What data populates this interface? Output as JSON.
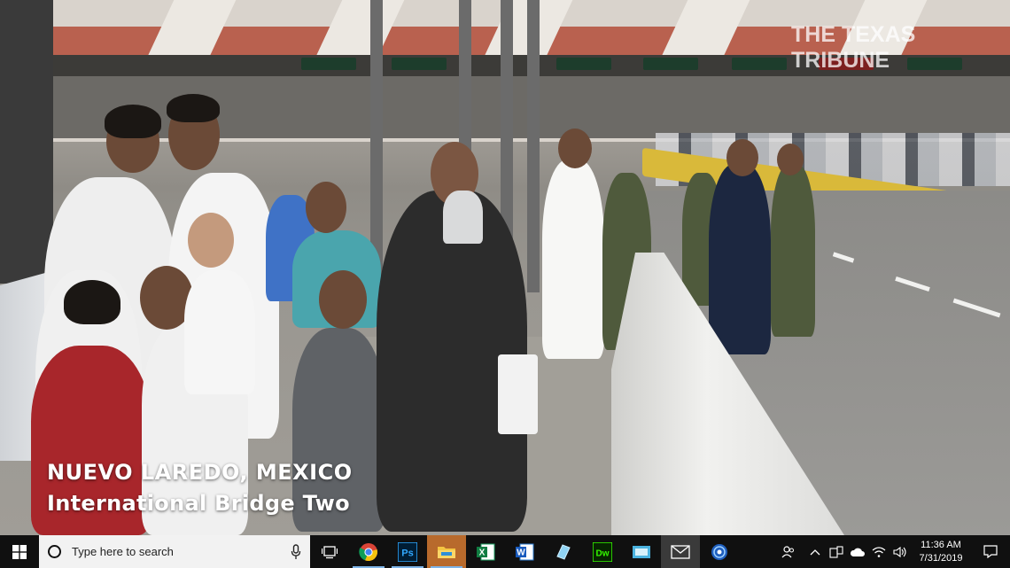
{
  "video": {
    "watermark": "THE TEXAS TRIBUNE",
    "caption_line1": "NUEVO LAREDO, MEXICO",
    "caption_line2": "International Bridge Two"
  },
  "taskbar": {
    "search_placeholder": "Type here to search",
    "apps": [
      {
        "name": "task-view",
        "icon": "task-view-icon"
      },
      {
        "name": "chrome",
        "icon": "chrome-icon"
      },
      {
        "name": "photoshop",
        "icon": "photoshop-icon",
        "label": "Ps"
      },
      {
        "name": "file-explorer",
        "icon": "folder-icon"
      },
      {
        "name": "excel",
        "icon": "excel-icon",
        "label": "X"
      },
      {
        "name": "word",
        "icon": "word-icon",
        "label": "W"
      },
      {
        "name": "app-blue",
        "icon": "app-icon"
      },
      {
        "name": "dreamweaver",
        "icon": "dreamweaver-icon",
        "label": "Dw"
      },
      {
        "name": "app-teal",
        "icon": "app-icon"
      },
      {
        "name": "mail",
        "icon": "mail-icon"
      },
      {
        "name": "app-globe",
        "icon": "globe-icon"
      }
    ],
    "clock": {
      "time": "11:36 AM",
      "date": "7/31/2019"
    }
  },
  "colors": {
    "taskbar_bg": "#101010",
    "search_bg": "#f2f2f2",
    "active_indicator": "#7fb5e8"
  }
}
